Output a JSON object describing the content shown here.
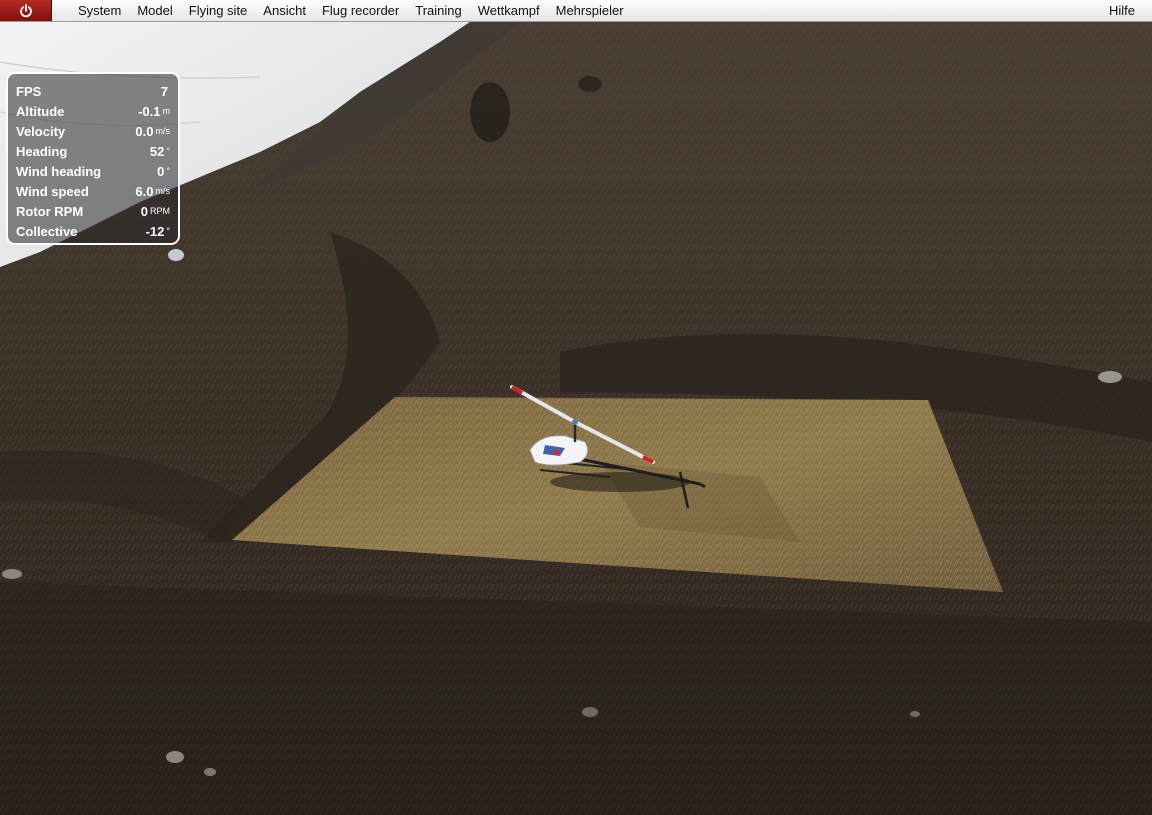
{
  "menu": {
    "items": [
      "System",
      "Model",
      "Flying site",
      "Ansicht",
      "Flug recorder",
      "Training",
      "Wettkampf",
      "Mehrspieler"
    ],
    "help": "Hilfe"
  },
  "hud": {
    "rows": [
      {
        "label": "FPS",
        "value": "7",
        "unit": ""
      },
      {
        "label": "Altitude",
        "value": "-0.1",
        "unit": "m"
      },
      {
        "label": "Velocity",
        "value": "0.0",
        "unit": "m/s"
      },
      {
        "label": "Heading",
        "value": "52",
        "unit": "°"
      },
      {
        "label": "Wind heading",
        "value": "0",
        "unit": "°"
      },
      {
        "label": "Wind speed",
        "value": "6.0",
        "unit": "m/s"
      },
      {
        "label": "Rotor RPM",
        "value": "0",
        "unit": "RPM"
      },
      {
        "label": "Collective",
        "value": "-12",
        "unit": "°"
      }
    ]
  },
  "icons": {
    "power": "power-icon",
    "helicopter": "helicopter-model"
  },
  "colors": {
    "power_button": "#9b1e17",
    "hud_border": "#ffffff",
    "landing_pad": "#8a7548"
  }
}
